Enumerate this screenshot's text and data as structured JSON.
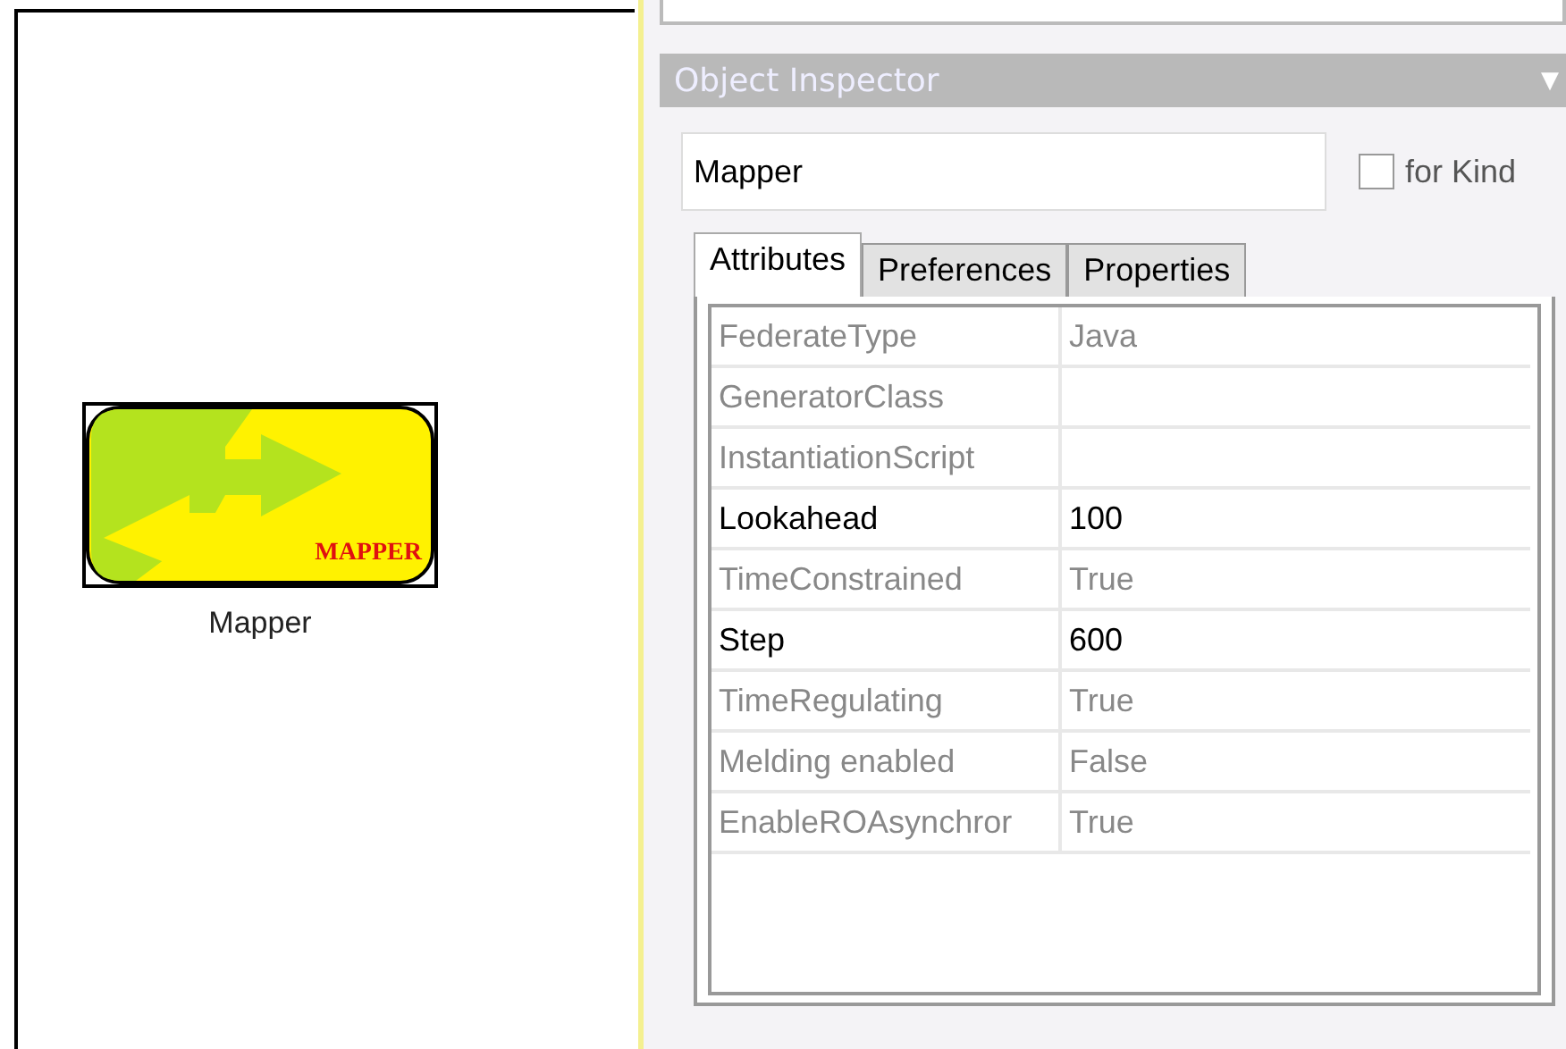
{
  "canvas": {
    "node": {
      "logo_text": "MAPPER",
      "label": "Mapper"
    }
  },
  "inspector": {
    "title": "Object Inspector",
    "menu_glyph": "▼",
    "name_field": {
      "value": "Mapper"
    },
    "for_kind": {
      "label": "for Kind",
      "checked": false
    },
    "tabs": [
      {
        "label": "Attributes",
        "selected": true
      },
      {
        "label": "Preferences",
        "selected": false
      },
      {
        "label": "Properties",
        "selected": false
      }
    ],
    "attributes": [
      {
        "name": "FederateType",
        "value": "Java",
        "modified": false
      },
      {
        "name": "GeneratorClass",
        "modified": false
      },
      {
        "name": "InstantiationScript",
        "modified": false
      },
      {
        "name": "Lookahead",
        "value": "100",
        "modified": true
      },
      {
        "name": "TimeConstrained",
        "value": "True",
        "modified": false
      },
      {
        "name": "Step",
        "value": "600",
        "modified": true
      },
      {
        "name": "TimeRegulating",
        "value": "True",
        "modified": false
      },
      {
        "name": "Melding enabled",
        "value": "False",
        "modified": false
      },
      {
        "name": "EnableROAsynchror",
        "value": "True",
        "modified": false
      }
    ]
  }
}
